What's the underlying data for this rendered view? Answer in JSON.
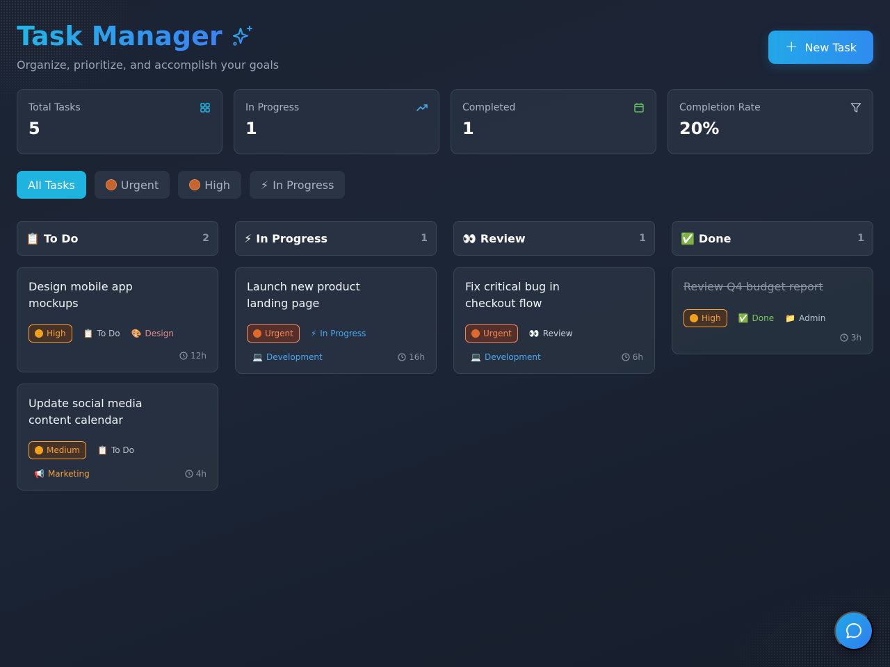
{
  "header": {
    "title": "Task Manager",
    "subtitle": "Organize, prioritize, and accomplish your goals",
    "new_task_label": "New Task"
  },
  "stats": [
    {
      "label": "Total Tasks",
      "value": "5",
      "icon": "grid-icon",
      "color": "#22b6e6"
    },
    {
      "label": "In Progress",
      "value": "1",
      "icon": "trending-up-icon",
      "color": "#4aa8ee"
    },
    {
      "label": "Completed",
      "value": "1",
      "icon": "calendar-icon",
      "color": "#5cc25a"
    },
    {
      "label": "Completion Rate",
      "value": "20%",
      "icon": "filter-icon",
      "color": "#aab3c2"
    }
  ],
  "filters": [
    {
      "label": "All Tasks",
      "active": true
    },
    {
      "label": "Urgent",
      "icon": "ball-icon"
    },
    {
      "label": "High",
      "icon": "ball-icon"
    },
    {
      "label": "In Progress",
      "icon": "lightning-icon"
    }
  ],
  "columns": [
    {
      "emoji": "📋",
      "title": "To Do",
      "count": "2"
    },
    {
      "emoji": "⚡",
      "title": "In Progress",
      "count": "1"
    },
    {
      "emoji": "👀",
      "title": "Review",
      "count": "1"
    },
    {
      "emoji": "✅",
      "title": "Done",
      "count": "1"
    }
  ],
  "cards": {
    "todo_1": {
      "title": "Design mobile app mockups",
      "priority": "High",
      "status": "To Do",
      "status_emoji": "📋",
      "category": "Design",
      "category_emoji": "🎨",
      "time": "12h"
    },
    "todo_2": {
      "title": "Update social media content calendar",
      "priority": "Medium",
      "status": "To Do",
      "status_emoji": "📋",
      "category": "Marketing",
      "category_emoji": "📢",
      "time": "4h"
    },
    "prog_1": {
      "title": "Launch new product landing page",
      "priority": "Urgent",
      "status": "In Progress",
      "status_emoji": "⚡",
      "category": "Development",
      "category_emoji": "💻",
      "time": "16h"
    },
    "review_1": {
      "title": "Fix critical bug in checkout flow",
      "priority": "Urgent",
      "status": "Review",
      "status_emoji": "👀",
      "category": "Development",
      "category_emoji": "💻",
      "time": "6h"
    },
    "done_1": {
      "title": "Review Q4 budget report",
      "priority": "High",
      "status": "Done",
      "status_emoji": "✅",
      "category": "Admin",
      "category_emoji": "📁",
      "time": "3h"
    }
  },
  "colors": {
    "accent": "#1fb4e0",
    "priority_high": "#f3a11b",
    "priority_urgent": "#e06a2c"
  },
  "chat": {
    "icon": "chat-bubble-icon"
  }
}
